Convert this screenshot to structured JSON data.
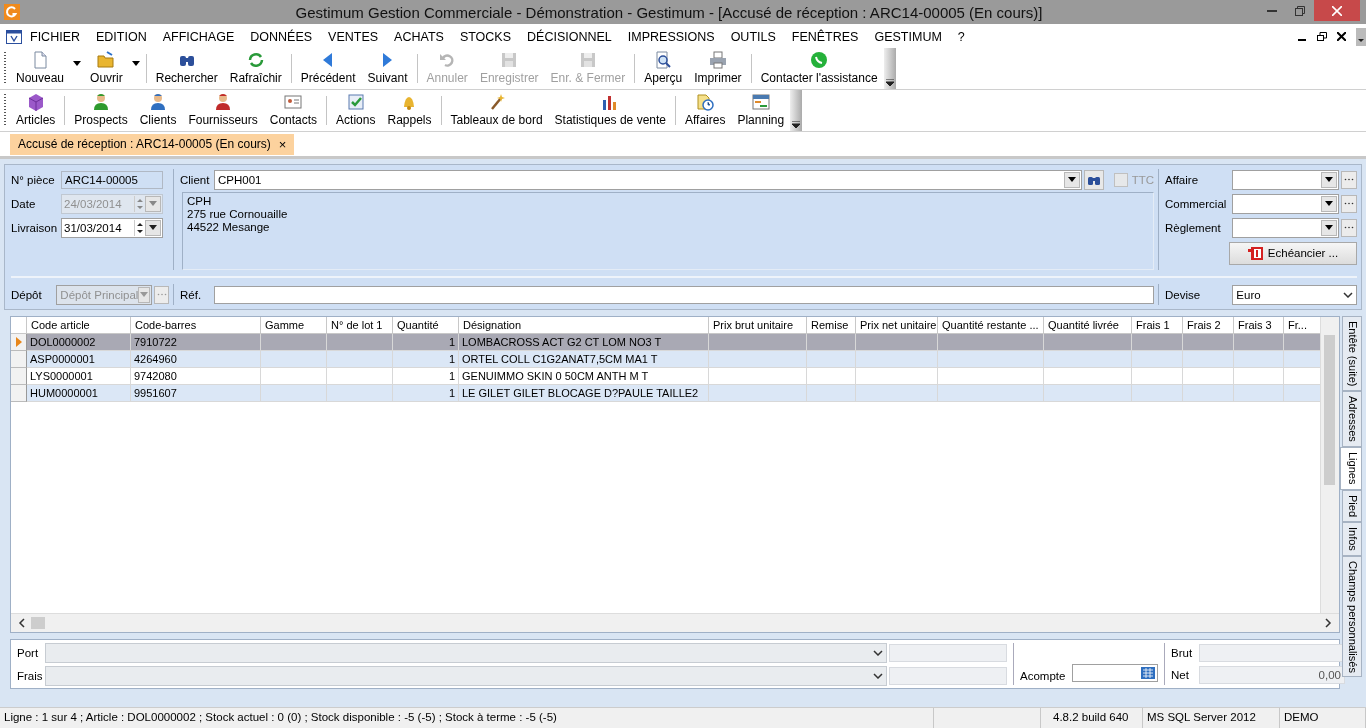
{
  "window": {
    "title": "Gestimum Gestion Commerciale - Démonstration - Gestimum - [Accusé de réception : ARC14-00005 (En cours)]"
  },
  "menu": [
    "FICHIER",
    "EDITION",
    "AFFICHAGE",
    "DONNÉES",
    "VENTES",
    "ACHATS",
    "STOCKS",
    "DÉCISIONNEL",
    "IMPRESSIONS",
    "OUTILS",
    "FENÊTRES",
    "GESTIMUM",
    "?"
  ],
  "toolbar1": [
    {
      "label": "Nouveau",
      "disabled": false,
      "dropdown": true,
      "separator_before": false
    },
    {
      "label": "Ouvrir",
      "disabled": false,
      "dropdown": true,
      "separator_before": false
    },
    {
      "label": "Rechercher",
      "disabled": false,
      "dropdown": false,
      "separator_before": true
    },
    {
      "label": "Rafraîchir",
      "disabled": false,
      "dropdown": false,
      "separator_before": false
    },
    {
      "label": "Précédent",
      "disabled": false,
      "dropdown": false,
      "separator_before": true
    },
    {
      "label": "Suivant",
      "disabled": false,
      "dropdown": false,
      "separator_before": false
    },
    {
      "label": "Annuler",
      "disabled": true,
      "dropdown": false,
      "separator_before": true
    },
    {
      "label": "Enregistrer",
      "disabled": true,
      "dropdown": false,
      "separator_before": false
    },
    {
      "label": "Enr. & Fermer",
      "disabled": true,
      "dropdown": false,
      "separator_before": false
    },
    {
      "label": "Aperçu",
      "disabled": false,
      "dropdown": false,
      "separator_before": true
    },
    {
      "label": "Imprimer",
      "disabled": false,
      "dropdown": false,
      "separator_before": false
    },
    {
      "label": "Contacter l'assistance",
      "disabled": false,
      "dropdown": false,
      "separator_before": true
    }
  ],
  "toolbar2": [
    {
      "label": "Articles",
      "separator_before": false
    },
    {
      "label": "Prospects",
      "separator_before": true
    },
    {
      "label": "Clients",
      "separator_before": false
    },
    {
      "label": "Fournisseurs",
      "separator_before": false
    },
    {
      "label": "Contacts",
      "separator_before": false
    },
    {
      "label": "Actions",
      "separator_before": true
    },
    {
      "label": "Rappels",
      "separator_before": false
    },
    {
      "label": "Tableaux de bord",
      "separator_before": true
    },
    {
      "label": "Statistiques de vente",
      "separator_before": false
    },
    {
      "label": "Affaires",
      "separator_before": true
    },
    {
      "label": "Planning",
      "separator_before": false
    }
  ],
  "document_tab": {
    "label": "Accusé de réception : ARC14-00005 (En cours)",
    "close": "×"
  },
  "form": {
    "piece": {
      "label": "N° pièce",
      "value": "ARC14-00005"
    },
    "date": {
      "label": "Date",
      "value": "24/03/2014",
      "disabled": true
    },
    "livraison": {
      "label": "Livraison",
      "value": "31/03/2014",
      "disabled": false
    },
    "client": {
      "label": "Client",
      "value": "CPH001"
    },
    "ttc": {
      "label": "TTC",
      "checked": false
    },
    "address": [
      "CPH",
      "275 rue Cornouaille",
      "44522 Mesange"
    ],
    "affaire": {
      "label": "Affaire"
    },
    "commercial": {
      "label": "Commercial"
    },
    "reglement": {
      "label": "Règlement"
    },
    "echeancier": {
      "label": "Echéancier ..."
    },
    "depot": {
      "label": "Dépôt",
      "value": "Dépôt Principal",
      "disabled": true
    },
    "ref": {
      "label": "Réf."
    },
    "devise": {
      "label": "Devise",
      "value": "Euro"
    }
  },
  "grid": {
    "columns": [
      "Code article",
      "Code-barres",
      "Gamme",
      "N° de lot 1",
      "Quantité",
      "Désignation",
      "Prix brut unitaire",
      "Remise",
      "Prix net unitaire",
      "Quantité restante ...",
      "Quantité livrée",
      "Frais 1",
      "Frais 2",
      "Frais 3",
      "Fr..."
    ],
    "rows": [
      {
        "selected": true,
        "code": "DOL0000002",
        "barcode": "7910722",
        "quantity": "1",
        "designation": "LOMBACROSS ACT G2 CT LOM NO3 T"
      },
      {
        "selected": false,
        "code": "ASP0000001",
        "barcode": "4264960",
        "quantity": "1",
        "designation": "ORTEL COLL C1G2ANAT7,5CM MA1 T"
      },
      {
        "selected": false,
        "code": "LYS0000001",
        "barcode": "9742080",
        "quantity": "1",
        "designation": "GENUIMMO SKIN 0 50CM ANTH  M T"
      },
      {
        "selected": false,
        "code": "HUM0000001",
        "barcode": "9951607",
        "quantity": "1",
        "designation": "LE GILET GILET BLOCAGE D?PAULE TAILLE2"
      }
    ]
  },
  "side_tabs": [
    {
      "label": "Entête (suite)",
      "selected": false
    },
    {
      "label": "Adresses",
      "selected": false
    },
    {
      "label": "Lignes",
      "selected": true
    },
    {
      "label": "Pied",
      "selected": false
    },
    {
      "label": "Infos",
      "selected": false
    },
    {
      "label": "Champs personnalisés",
      "selected": false
    }
  ],
  "footer": {
    "port": {
      "label": "Port"
    },
    "frais": {
      "label": "Frais"
    },
    "acompte": {
      "label": "Acompte"
    },
    "brut": {
      "label": "Brut"
    },
    "net": {
      "label": "Net",
      "value": "0,00"
    }
  },
  "status_bar": [
    "Ligne : 1 sur 4 ; Article : DOL0000002 ; Stock actuel : 0 (0) ; Stock disponible : -5 (-5) ; Stock à terme : -5 (-5)",
    "4.8.2 build 640",
    "MS SQL Server 2012",
    "DEMO"
  ]
}
